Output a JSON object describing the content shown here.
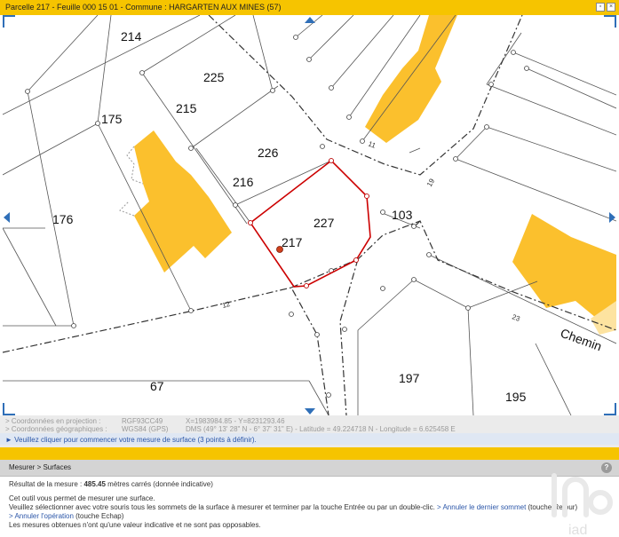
{
  "window": {
    "title": "Parcelle 217 - Feuille 000 15 01 - Commune : HARGARTEN AUX MINES (57)",
    "icon_restore": "restore-icon",
    "icon_close": "close-icon"
  },
  "map": {
    "parcels": [
      "214",
      "225",
      "215",
      "175",
      "226",
      "216",
      "227",
      "217",
      "103",
      "176",
      "67",
      "197",
      "195"
    ],
    "street_label": "Chemin",
    "street_numbers": [
      "11",
      "19",
      "23",
      "12"
    ]
  },
  "coords": {
    "proj_label": "> Coordonnées en projection :",
    "proj_system": "RGF93CC49",
    "proj_value": "X=1983984.85 - Y=8231293.46",
    "geo_label": "> Coordonnées géographiques :",
    "geo_system": "WGS84 (GPS)",
    "geo_value": "DMS (49° 13' 28\" N - 6° 37' 31\" E) - Latitude = 49.224718 N - Longitude = 6.625458 E",
    "hint": "► Veuillez cliquer pour commencer votre mesure de surface (3 points à définir)."
  },
  "measure": {
    "breadcrumb": "Mesurer > Surfaces",
    "help_icon": "help-icon",
    "result_prefix": "Résultat de la mesure : ",
    "result_value": "485.45",
    "result_suffix": " mètres carrés (donnée indicative)",
    "line1": "Cet outil vous permet de mesurer une surface.",
    "line2_a": "Veuillez sélectionner avec votre souris tous les sommets de la surface à mesurer et terminer par la touche Entrée ou par un double-clic.",
    "line2_link": " > Annuler le dernier sommet",
    "line2_b": " (touche Retour)",
    "line3_link": "> Annuler l'opération",
    "line3_b": " (touche Echap)",
    "line4": "Les mesures obtenues n'ont qu'une valeur indicative et ne sont pas opposables."
  },
  "colors": {
    "accent": "#f6c400",
    "building": "#fbc02d",
    "selection": "#cc0000",
    "link": "#2b56a8"
  }
}
